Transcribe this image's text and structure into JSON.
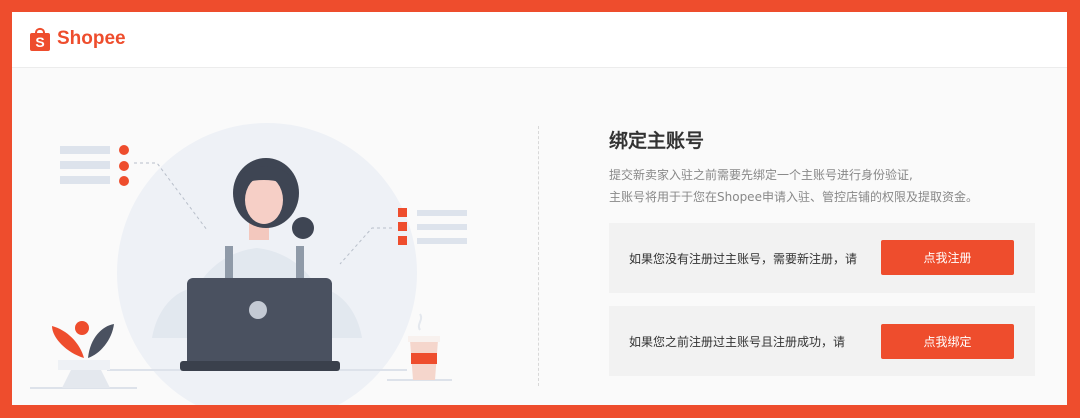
{
  "brand": {
    "logo_text": "Shopee",
    "accent_color": "#ee4d2d"
  },
  "main": {
    "title": "绑定主账号",
    "description_lines": [
      "提交新卖家入驻之前需要先绑定一个主账号进行身份验证,",
      "主账号将用于于您在Shopee申请入驻、管控店铺的权限及提取资金。"
    ],
    "cards": [
      {
        "text": "如果您没有注册过主账号，需要新注册，请",
        "button_label": "点我注册"
      },
      {
        "text": "如果您之前注册过主账号且注册成功，请",
        "button_label": "点我绑定"
      }
    ]
  },
  "icons": {
    "logo": "shopping-bag-icon",
    "illustration": "person-with-laptop-illustration"
  }
}
